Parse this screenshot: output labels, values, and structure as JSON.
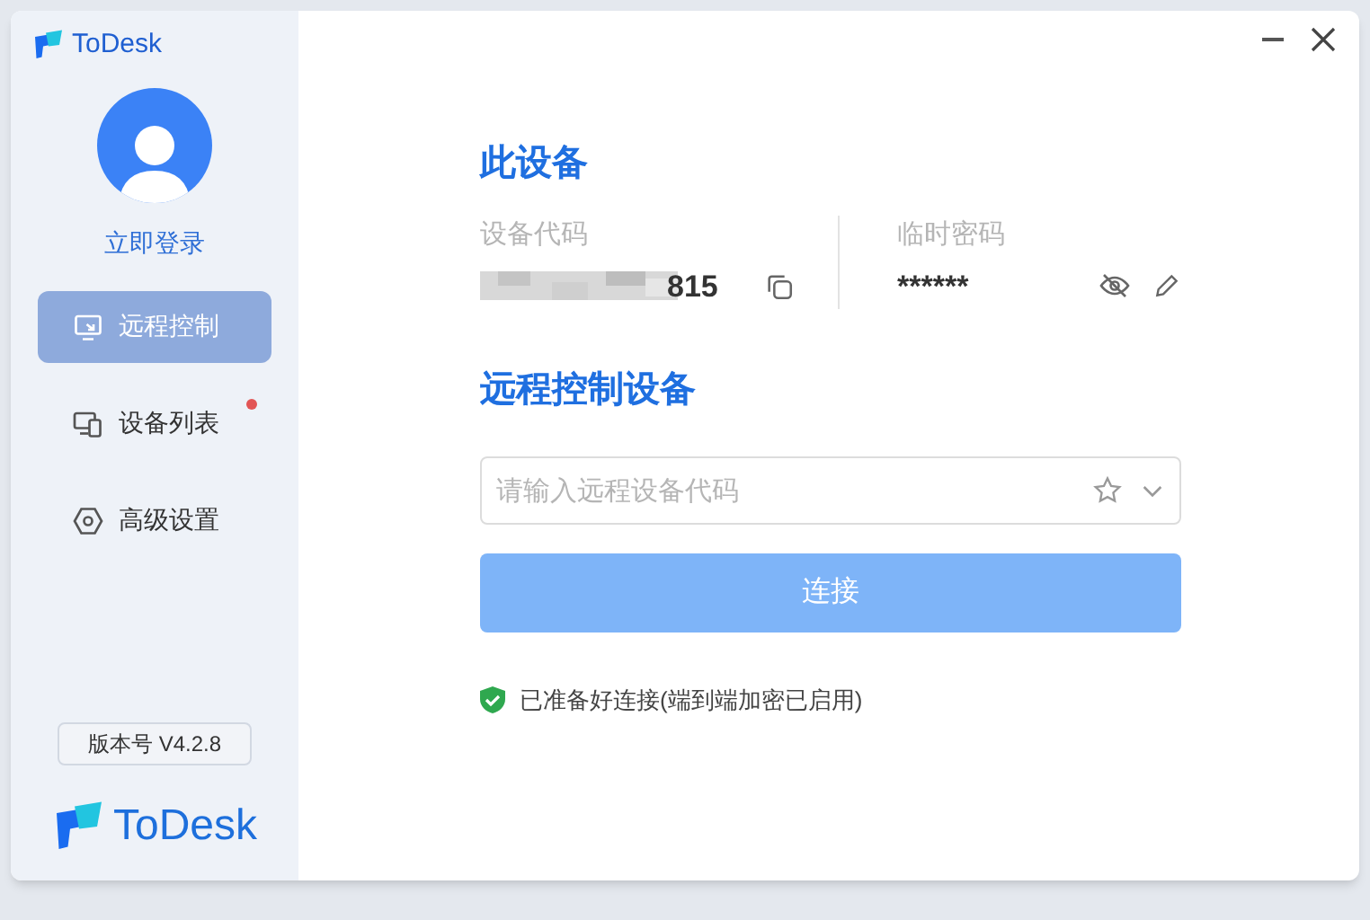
{
  "window": {
    "title": "ToDesk"
  },
  "sidebar": {
    "login": "立即登录",
    "items": [
      {
        "label": "远程控制",
        "kind": "monitor",
        "selected": true,
        "notification_dot": false
      },
      {
        "label": "设备列表",
        "kind": "devices",
        "selected": false,
        "notification_dot": true
      },
      {
        "label": "高级设置",
        "kind": "gear",
        "selected": false,
        "notification_dot": false
      }
    ],
    "version": "版本号 V4.2.8",
    "brand": "ToDesk"
  },
  "this_device": {
    "heading": "此设备",
    "code_label": "设备代码",
    "code_visible_part": "815",
    "password_label": "临时密码",
    "password": "******"
  },
  "remote": {
    "heading": "远程控制设备",
    "placeholder": "请输入远程设备代码",
    "connect_button": "连接",
    "connect_disabled": true,
    "status": "已准备好连接(端到端加密已启用)"
  }
}
